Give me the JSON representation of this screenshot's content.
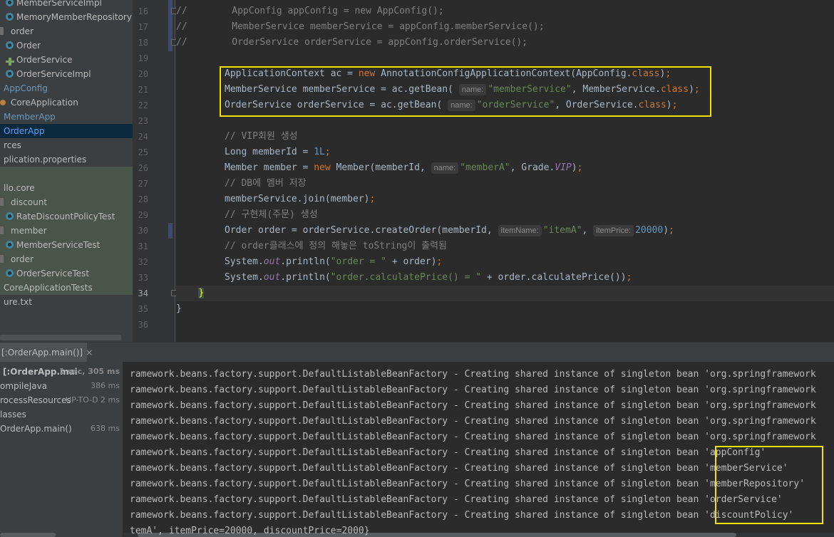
{
  "project_tree": [
    {
      "label": "MemberServiceImpl",
      "icon": "class-icon",
      "indent": 8,
      "style": ""
    },
    {
      "label": "MemoryMemberRepository",
      "icon": "class-icon",
      "indent": 8,
      "style": ""
    },
    {
      "label": "order",
      "icon": "folder-icon",
      "indent": 0,
      "style": ""
    },
    {
      "label": "Order",
      "icon": "class-icon",
      "indent": 8,
      "style": ""
    },
    {
      "label": "OrderService",
      "icon": "interface-icon",
      "indent": 8,
      "style": ""
    },
    {
      "label": "OrderServiceImpl",
      "icon": "class-icon",
      "indent": 8,
      "style": ""
    },
    {
      "label": "AppConfig",
      "icon": "",
      "indent": 0,
      "style": "blue"
    },
    {
      "label": "CoreApplication",
      "icon": "java-icon",
      "indent": 0,
      "style": ""
    },
    {
      "label": "MemberApp",
      "icon": "",
      "indent": 0,
      "style": "blue"
    },
    {
      "label": "OrderApp",
      "icon": "",
      "indent": 0,
      "style": "link",
      "selected": true
    },
    {
      "label": "rces",
      "icon": "",
      "indent": 0,
      "style": ""
    },
    {
      "label": "plication.properties",
      "icon": "",
      "indent": 0,
      "style": ""
    },
    {
      "label": "",
      "icon": "",
      "indent": 0,
      "style": "",
      "test": true
    },
    {
      "label": "llo.core",
      "icon": "",
      "indent": 0,
      "style": "",
      "test": true
    },
    {
      "label": "discount",
      "icon": "folder-icon",
      "indent": 0,
      "style": "",
      "test": true
    },
    {
      "label": "RateDiscountPolicyTest",
      "icon": "class-icon",
      "indent": 8,
      "style": "",
      "test": true
    },
    {
      "label": "member",
      "icon": "folder-icon",
      "indent": 0,
      "style": "",
      "test": true
    },
    {
      "label": "MemberServiceTest",
      "icon": "class-icon",
      "indent": 8,
      "style": "",
      "test": true
    },
    {
      "label": "order",
      "icon": "folder-icon",
      "indent": 0,
      "style": "",
      "test": true
    },
    {
      "label": "OrderServiceTest",
      "icon": "class-icon",
      "indent": 8,
      "style": "",
      "test": true
    },
    {
      "label": "CoreApplicationTests",
      "icon": "",
      "indent": 0,
      "style": "",
      "test": true
    },
    {
      "label": "ure.txt",
      "icon": "",
      "indent": 0,
      "style": ""
    }
  ],
  "editor": {
    "line_numbers": [
      "16",
      "17",
      "18",
      "19",
      "20",
      "21",
      "22",
      "23",
      "24",
      "25",
      "26",
      "27",
      "28",
      "29",
      "30",
      "31",
      "32",
      "33",
      "34",
      "35",
      "36"
    ],
    "current_line": "34"
  },
  "run_panel": {
    "tab_label": "[:OrderApp.main()]",
    "tab_close": "×",
    "tree": [
      {
        "label": "[:OrderApp.mai",
        "time": "1 sec, 305 ms",
        "bold": true
      },
      {
        "label": "ompileJava",
        "time": "386 ms",
        "bold": false
      },
      {
        "label": "rocessResources",
        "time": "UP-TO-D 2 ms",
        "bold": false
      },
      {
        "label": "lasses",
        "time": "",
        "bold": false
      },
      {
        "label": "OrderApp.main()",
        "time": "638 ms",
        "bold": false
      }
    ],
    "console_prefix": "ramework.beans.factory.support.DefaultListableBeanFactory - Creating shared instance of singleton bean ",
    "console_lines": [
      "'org.springframework",
      "'org.springframework",
      "'org.springframework",
      "'org.springframework",
      "'org.springframework",
      "'appConfig'",
      "'memberService'",
      "'memberRepository'",
      "'orderService'",
      "'discountPolicy'"
    ],
    "console_last": "temA', itemPrice=20000, discountPrice=2000}"
  }
}
